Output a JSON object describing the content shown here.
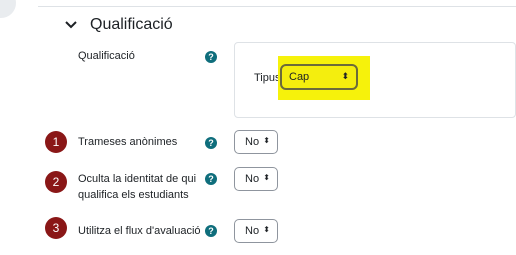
{
  "section": {
    "title": "Qualificació"
  },
  "grade": {
    "label": "Qualificació",
    "help": "?",
    "type_label": "Tipus",
    "type_value": "Cap",
    "arrow": "⬍"
  },
  "rows": [
    {
      "badge": "1",
      "label": "Trameses anònimes",
      "help": "?",
      "value": "No"
    },
    {
      "badge": "2",
      "label_line1": "Oculta la identitat de qui",
      "label_line2": "qualifica els estudiants",
      "help": "?",
      "value": "No"
    },
    {
      "badge": "3",
      "label": "Utilitza el flux d'avaluació",
      "help": "?",
      "value": "No"
    }
  ],
  "colors": {
    "help": "#0f6e7c",
    "badge": "#8a1717",
    "highlight": "#f6f20b"
  }
}
